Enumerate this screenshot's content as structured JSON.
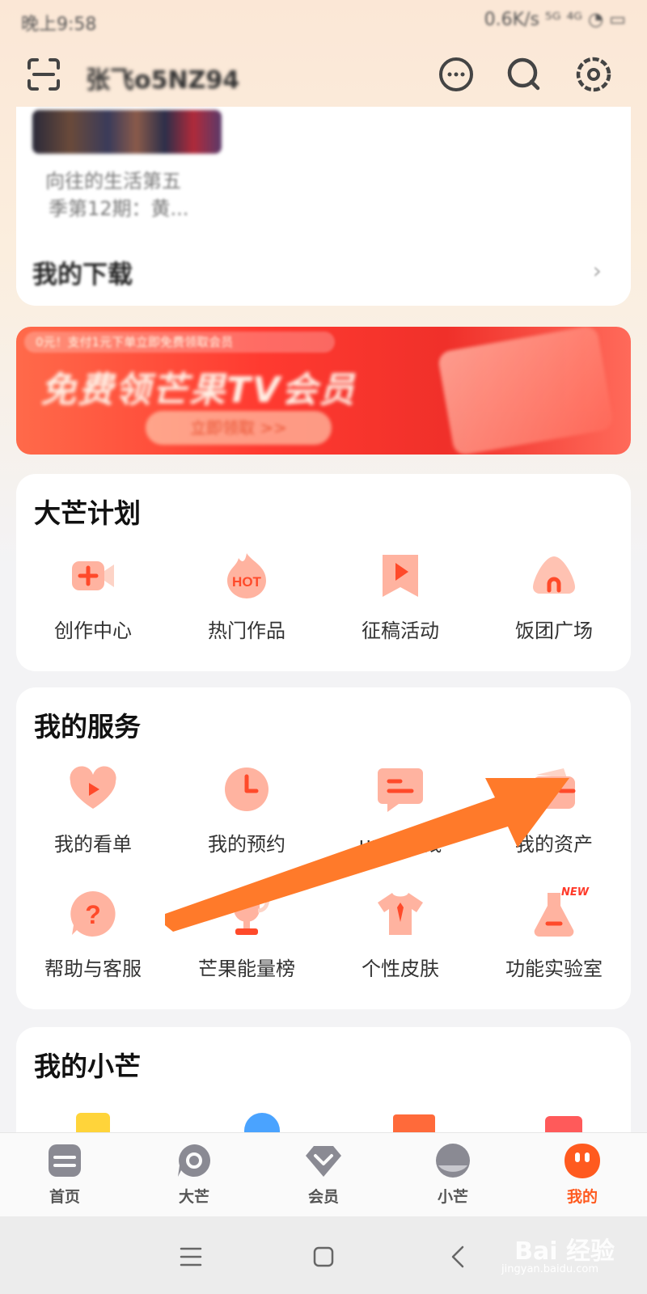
{
  "status_bar": {
    "time": "晚上9:58",
    "indicators": "0.6K/s ⁵ᴳ ⁴ᴳ ◔ ▭"
  },
  "header": {
    "username": "张飞o5NZ94",
    "icons": [
      "scan-icon",
      "message-icon",
      "search-icon",
      "settings-icon"
    ]
  },
  "history_card": {
    "item_lines": [
      "向往的生活第五",
      "季第12期：黄..."
    ],
    "downloads_label": "我的下载",
    "arrow": "›"
  },
  "banner": {
    "top_text": "0元！支付1元下单立即免费领取会员",
    "title": "免费领芒果TV会员",
    "button": "立即领取 >>"
  },
  "dam_plan": {
    "title": "大芒计划",
    "items": [
      {
        "label": "创作中心",
        "icon": "video-plus-icon"
      },
      {
        "label": "热门作品",
        "icon": "hot-flame-icon"
      },
      {
        "label": "征稿活动",
        "icon": "play-bookmark-icon"
      },
      {
        "label": "饭团广场",
        "icon": "rice-ball-icon"
      }
    ]
  },
  "my_services": {
    "title": "我的服务",
    "row1": [
      {
        "label": "我的看单",
        "icon": "heart-play-icon"
      },
      {
        "label": "我的预约",
        "icon": "clock-icon"
      },
      {
        "label": "up主赚钱",
        "icon": "chat-bubble-icon"
      },
      {
        "label": "我的资产",
        "icon": "wallet-icon"
      }
    ],
    "row2": [
      {
        "label": "帮助与客服",
        "icon": "question-icon"
      },
      {
        "label": "芒果能量榜",
        "icon": "trophy-icon"
      },
      {
        "label": "个性皮肤",
        "icon": "shirt-icon"
      },
      {
        "label": "功能实验室",
        "icon": "flask-icon",
        "badge": "NEW"
      }
    ]
  },
  "my_xiaomang": {
    "title": "我的小芒"
  },
  "bottom_nav": [
    {
      "label": "首页",
      "icon": "home-icon",
      "active": false
    },
    {
      "label": "大芒",
      "icon": "dam-icon",
      "active": false
    },
    {
      "label": "会员",
      "icon": "vip-icon",
      "active": false
    },
    {
      "label": "小芒",
      "icon": "xiaomang-icon",
      "active": false
    },
    {
      "label": "我的",
      "icon": "mine-icon",
      "active": true
    }
  ],
  "watermark": {
    "text": "Bai 经验",
    "sub": "jingyan.baidu.com"
  },
  "colors": {
    "accent": "#ff5a1f",
    "icon_bg": "#fde0d4",
    "icon_fg": "#ff5a2a",
    "annotation_arrow": "#ff7a2a"
  }
}
